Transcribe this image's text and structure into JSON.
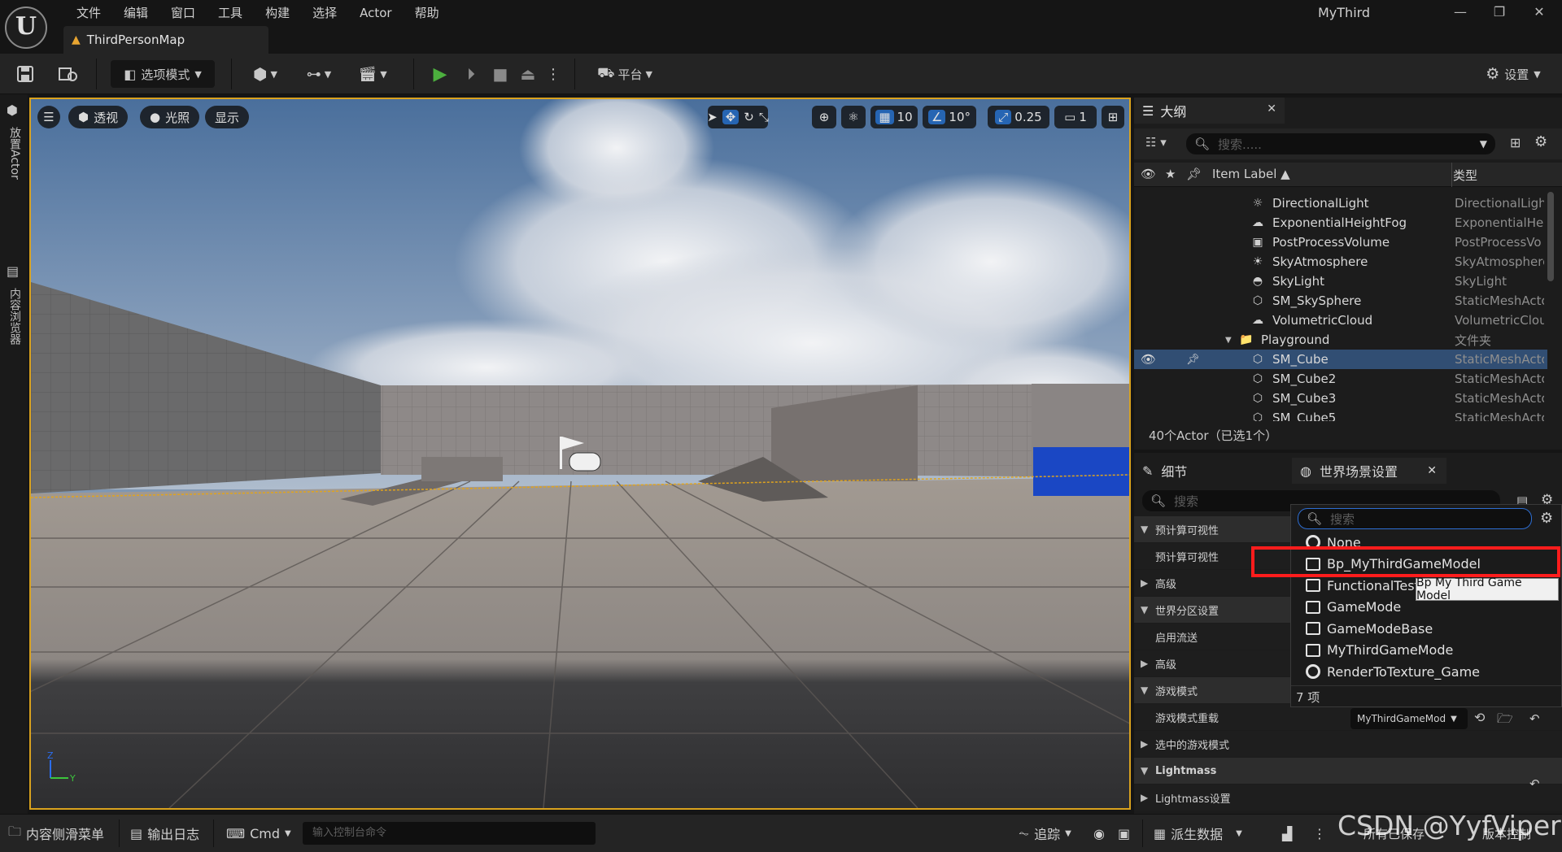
{
  "app": {
    "project": "MyThird",
    "doc_tab": "ThirdPersonMap",
    "logo_text": "U"
  },
  "menu": [
    "文件",
    "编辑",
    "窗口",
    "工具",
    "构建",
    "选择",
    "Actor",
    "帮助"
  ],
  "toolbar": {
    "mode_label": "选项模式",
    "platform_label": "平台",
    "settings_label": "设置"
  },
  "leftstrip": {
    "place_actors": "放置Actor",
    "content_browser": "内容浏览器"
  },
  "viewport": {
    "perspective": "透视",
    "lit": "光照",
    "show": "显示",
    "grid_size": "10",
    "rotation_snap": "10°",
    "scale_snap": "0.25",
    "camera_speed": "1",
    "axis_z": "Z",
    "axis_y": "Y"
  },
  "outliner": {
    "tab": "大纲",
    "search_placeholder": "搜索.....",
    "col_label": "Item Label ▲",
    "col_type": "类型",
    "rows": [
      {
        "label": "DirectionalLight",
        "type": "DirectionalLigh",
        "icon": "☼"
      },
      {
        "label": "ExponentialHeightFog",
        "type": "ExponentialHei",
        "icon": "☁"
      },
      {
        "label": "PostProcessVolume",
        "type": "PostProcessVo",
        "icon": "▣"
      },
      {
        "label": "SkyAtmosphere",
        "type": "SkyAtmosphere",
        "icon": "☀"
      },
      {
        "label": "SkyLight",
        "type": "SkyLight",
        "icon": "◓"
      },
      {
        "label": "SM_SkySphere",
        "type": "StaticMeshActo",
        "icon": "⬡"
      },
      {
        "label": "VolumetricCloud",
        "type": "VolumetricClou",
        "icon": "☁"
      },
      {
        "label": "Playground",
        "type": "文件夹",
        "icon": "📁"
      },
      {
        "label": "SM_Cube",
        "type": "StaticMeshActo",
        "icon": "⬡"
      },
      {
        "label": "SM_Cube2",
        "type": "StaticMeshActo",
        "icon": "⬡"
      },
      {
        "label": "SM_Cube3",
        "type": "StaticMeshActo",
        "icon": "⬡"
      },
      {
        "label": "SM_Cube5",
        "type": "StaticMeshActo",
        "icon": "⬡"
      }
    ],
    "actor_count": "40个Actor（已选1个）"
  },
  "details": {
    "tab_details": "细节",
    "tab_world": "世界场景设置",
    "search_placeholder": "搜索",
    "sections": [
      {
        "text": "预计算可视性",
        "kind": "hdr",
        "arrow": "▼"
      },
      {
        "text": "预计算可视性",
        "kind": "sub",
        "arrow": ""
      },
      {
        "text": "高级",
        "kind": "sub",
        "arrow": "▶"
      },
      {
        "text": "世界分区设置",
        "kind": "hdr",
        "arrow": "▼"
      },
      {
        "text": "启用流送",
        "kind": "sub",
        "arrow": ""
      },
      {
        "text": "高级",
        "kind": "sub",
        "arrow": "▶"
      },
      {
        "text": "游戏模式",
        "kind": "hdr",
        "arrow": "▼"
      },
      {
        "text": "游戏模式重载",
        "kind": "sub",
        "arrow": ""
      },
      {
        "text": "选中的游戏模式",
        "kind": "sub",
        "arrow": "▶"
      },
      {
        "text": "Lightmass",
        "kind": "hdr",
        "arrow": "▼"
      },
      {
        "text": "Lightmass设置",
        "kind": "sub",
        "arrow": "▶"
      }
    ],
    "gamemode_override_value": "MyThirdGameMod"
  },
  "dropdown": {
    "search_placeholder": "搜索",
    "items": [
      {
        "label": "None",
        "icon": "circle"
      },
      {
        "label": "Bp_MyThirdGameModel",
        "icon": "bp"
      },
      {
        "label": "FunctionalTest",
        "icon": "bp"
      },
      {
        "label": "GameMode",
        "icon": "bp"
      },
      {
        "label": "GameModeBase",
        "icon": "bp"
      },
      {
        "label": "MyThirdGameMode",
        "icon": "bp"
      },
      {
        "label": "RenderToTexture_Game",
        "icon": "circle"
      }
    ],
    "count": "7 项",
    "tooltip": "Bp My Third Game Model"
  },
  "statusbar": {
    "drawer": "内容侧滑菜单",
    "output_log": "输出日志",
    "cmd": "Cmd",
    "console_placeholder": "输入控制台命令",
    "trace": "追踪",
    "derived_data": "派生数据",
    "save_all": "所有已保存",
    "source_control": "版本控制"
  },
  "watermark": "CSDN @YyfViper"
}
